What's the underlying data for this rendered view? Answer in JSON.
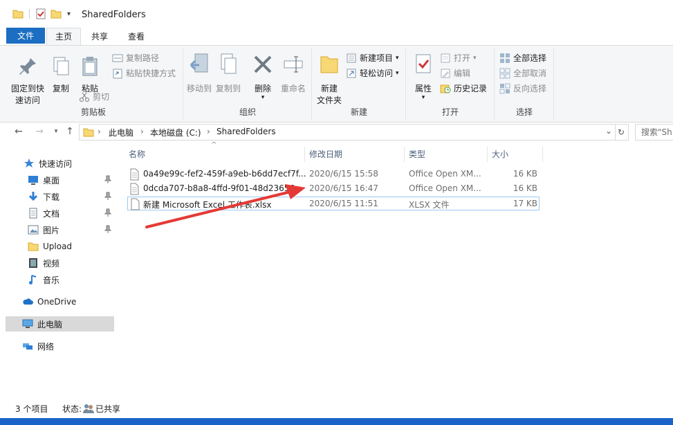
{
  "window": {
    "title": "SharedFolders"
  },
  "tabs": [
    {
      "label": "文件"
    },
    {
      "label": "主页"
    },
    {
      "label": "共享"
    },
    {
      "label": "查看"
    }
  ],
  "ribbon": {
    "clipboard": {
      "label": "剪贴板",
      "pin_line1": "固定到快",
      "pin_line2": "速访问",
      "copy": "复制",
      "paste": "粘贴",
      "copy_path": "复制路径",
      "paste_shortcut": "粘贴快捷方式",
      "cut": "剪切"
    },
    "organize": {
      "label": "组织",
      "move_to": "移动到",
      "copy_to": "复制到",
      "delete": "删除",
      "rename": "重命名"
    },
    "new": {
      "label": "新建",
      "new_folder_line1": "新建",
      "new_folder_line2": "文件夹",
      "new_item": "新建项目",
      "easy_access": "轻松访问"
    },
    "open": {
      "label": "打开",
      "properties": "属性",
      "open": "打开",
      "edit": "编辑",
      "history": "历史记录"
    },
    "select": {
      "label": "选择",
      "select_all": "全部选择",
      "select_none": "全部取消",
      "invert": "反向选择"
    }
  },
  "address": {
    "crumbs": [
      "此电脑",
      "本地磁盘 (C:)",
      "SharedFolders"
    ],
    "search_placeholder": "搜索\"Sh"
  },
  "nav": {
    "quick_access": "快速访问",
    "items": [
      {
        "label": "桌面",
        "icon": "desktop-icon"
      },
      {
        "label": "下载",
        "icon": "download-icon"
      },
      {
        "label": "文档",
        "icon": "document-icon"
      },
      {
        "label": "图片",
        "icon": "picture-icon"
      },
      {
        "label": "Upload",
        "icon": "folder-icon"
      },
      {
        "label": "视频",
        "icon": "video-icon"
      },
      {
        "label": "音乐",
        "icon": "music-icon"
      }
    ],
    "onedrive": "OneDrive",
    "this_pc": "此电脑",
    "network": "网络"
  },
  "files": {
    "headers": {
      "name": "名称",
      "date": "修改日期",
      "type": "类型",
      "size": "大小"
    },
    "rows": [
      {
        "name": "0a49e99c-fef2-459f-a9eb-b6dd7ecf7f...",
        "date": "2020/6/15 15:58",
        "type": "Office Open XM...",
        "size": "16 KB"
      },
      {
        "name": "0dcda707-b8a8-4ffd-9f01-48d23656...",
        "date": "2020/6/15 16:47",
        "type": "Office Open XM...",
        "size": "16 KB"
      },
      {
        "name": "新建 Microsoft Excel 工作表.xlsx",
        "date": "2020/6/15 11:51",
        "type": "XLSX 文件",
        "size": "17 KB"
      }
    ]
  },
  "status": {
    "count": "3 个项目",
    "state_label": "状态:",
    "state_value": "已共享"
  },
  "colors": {
    "accent": "#1b6ec2",
    "arrow": "#e53935",
    "selection": "#d9d9d9"
  }
}
